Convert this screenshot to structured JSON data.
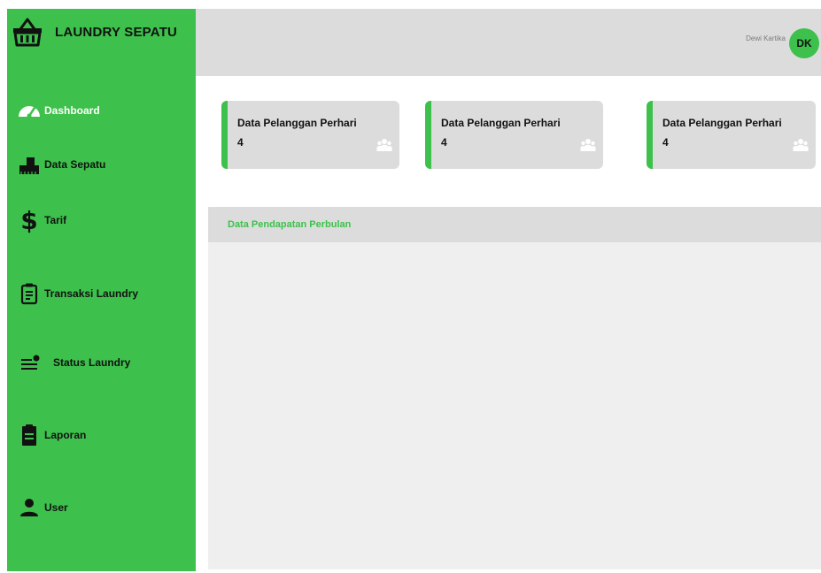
{
  "brand": {
    "title": "LAUNDRY SEPATU",
    "icon": "basket-icon"
  },
  "sidebar": {
    "items": [
      {
        "label": "Dashboard",
        "icon": "gauge-icon",
        "active": true
      },
      {
        "label": "Data Sepatu",
        "icon": "shoe-icon"
      },
      {
        "label": "Tarif",
        "icon": "dollar-icon"
      },
      {
        "label": "Transaksi Laundry",
        "icon": "clipboard-list-icon"
      },
      {
        "label": "Status Laundry",
        "icon": "status-list-icon"
      },
      {
        "label": "Laporan",
        "icon": "report-icon"
      },
      {
        "label": "User",
        "icon": "user-icon"
      }
    ]
  },
  "topbar": {
    "user_name": "Dewi Kartika",
    "avatar_initials": "DK"
  },
  "cards": [
    {
      "title": "Data Pelanggan Perhari",
      "value": "4",
      "icon": "users-icon"
    },
    {
      "title": "Data Pelanggan Perhari",
      "value": "4",
      "icon": "users-icon"
    },
    {
      "title": "Data Pelanggan Perhari",
      "value": "4",
      "icon": "users-icon"
    }
  ],
  "panel": {
    "title": "Data Pendapatan Perbulan"
  },
  "colors": {
    "accent": "#3dc14c",
    "topbar": "#dcdcdc",
    "panel_bg": "#efefef"
  }
}
